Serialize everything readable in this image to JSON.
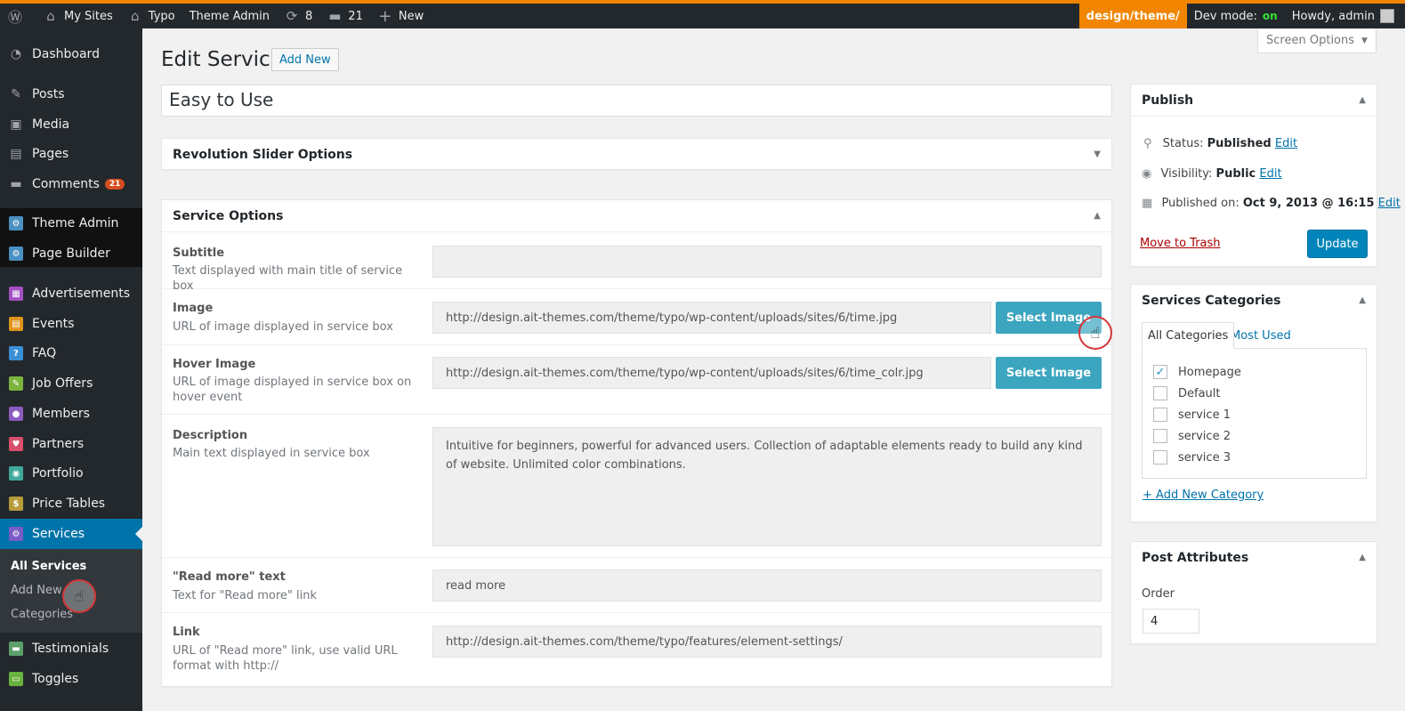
{
  "adminbar": {
    "my_sites": "My Sites",
    "site_name": "Typo",
    "theme_admin": "Theme Admin",
    "updates_count": "8",
    "comments_count": "21",
    "new_label": "New",
    "design_path": "design/theme/",
    "dev_mode_label": "Dev mode:",
    "dev_mode_value": "on",
    "howdy": "Howdy, admin"
  },
  "menu": {
    "dashboard": "Dashboard",
    "posts": "Posts",
    "media": "Media",
    "pages": "Pages",
    "comments": "Comments",
    "comments_badge": "21",
    "theme_admin": "Theme Admin",
    "page_builder": "Page Builder",
    "advertisements": "Advertisements",
    "events": "Events",
    "faq": "FAQ",
    "job_offers": "Job Offers",
    "members": "Members",
    "partners": "Partners",
    "portfolio": "Portfolio",
    "price_tables": "Price Tables",
    "services": "Services",
    "testimonials": "Testimonials",
    "toggles": "Toggles",
    "sub_all_services": "All Services",
    "sub_add_new": "Add New",
    "sub_categories": "Categories"
  },
  "header": {
    "title": "Edit Service",
    "add_new": "Add New",
    "screen_options": "Screen Options"
  },
  "post_title": "Easy to Use",
  "revolution_box": {
    "title": "Revolution Slider Options"
  },
  "service_options": {
    "title": "Service Options",
    "subtitle": {
      "label": "Subtitle",
      "help": "Text displayed with main title of service box",
      "value": ""
    },
    "image": {
      "label": "Image",
      "help": "URL of image displayed in service box",
      "value": "http://design.ait-themes.com/theme/typo/wp-content/uploads/sites/6/time.jpg",
      "button": "Select Image"
    },
    "hover_image": {
      "label": "Hover Image",
      "help": "URL of image displayed in service box on hover event",
      "value": "http://design.ait-themes.com/theme/typo/wp-content/uploads/sites/6/time_colr.jpg",
      "button": "Select Image"
    },
    "description": {
      "label": "Description",
      "help": "Main text displayed in service box",
      "value": "Intuitive for beginners, powerful for advanced users. Collection of adaptable elements ready to build any kind of website. Unlimited color combinations."
    },
    "read_more": {
      "label": "\"Read more\" text",
      "help": "Text for \"Read more\" link",
      "value": "read more"
    },
    "link": {
      "label": "Link",
      "help": "URL of \"Read more\" link, use valid URL format with http://",
      "value": "http://design.ait-themes.com/theme/typo/features/element-settings/"
    }
  },
  "publish": {
    "title": "Publish",
    "status_label": "Status:",
    "status_value": "Published",
    "visibility_label": "Visibility:",
    "visibility_value": "Public",
    "published_on_label": "Published on:",
    "published_on_value": "Oct 9, 2013 @ 16:15",
    "edit": "Edit",
    "trash": "Move to Trash",
    "update": "Update"
  },
  "categories": {
    "title": "Services Categories",
    "tab_all": "All Categories",
    "tab_most_used": "Most Used",
    "items": [
      {
        "label": "Homepage",
        "checked": true
      },
      {
        "label": "Default",
        "checked": false
      },
      {
        "label": "service 1",
        "checked": false
      },
      {
        "label": "service 2",
        "checked": false
      },
      {
        "label": "service 3",
        "checked": false
      }
    ],
    "add_new": "+ Add New Category"
  },
  "attributes": {
    "title": "Post Attributes",
    "order_label": "Order",
    "order_value": "4"
  },
  "colors": {
    "accent": "#f18500",
    "primary": "#0073aa",
    "select_button": "#3ca5c0",
    "badge": "#d54e21"
  }
}
